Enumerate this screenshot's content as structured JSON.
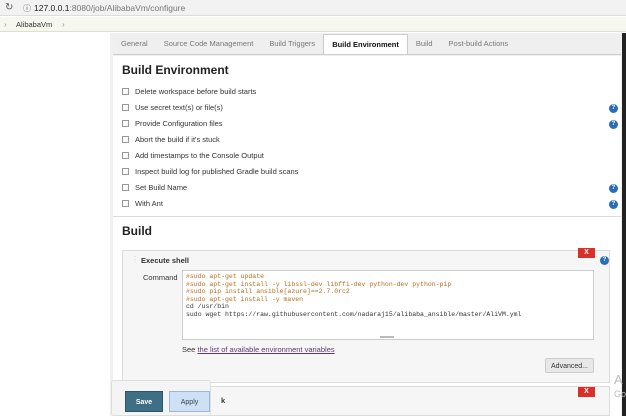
{
  "browser": {
    "reload_icon": "reload-icon",
    "info_icon": "info-icon",
    "url_host": "127.0.0.1",
    "url_rest": ":8080/job/AlibabaVm/configure"
  },
  "breadcrumb": {
    "item": "AlibabaVm",
    "sep": "›"
  },
  "tabs": [
    "General",
    "Source Code Management",
    "Build Triggers",
    "Build Environment",
    "Build",
    "Post-build Actions"
  ],
  "build_env": {
    "title": "Build Environment",
    "options": [
      {
        "label": "Delete workspace before build starts",
        "help": false
      },
      {
        "label": "Use secret text(s) or file(s)",
        "help": true
      },
      {
        "label": "Provide Configuration files",
        "help": true
      },
      {
        "label": "Abort the build if it's stuck",
        "help": false
      },
      {
        "label": "Add timestamps to the Console Output",
        "help": false
      },
      {
        "label": "Inspect build log for published Gradle build scans",
        "help": false
      },
      {
        "label": "Set Build Name",
        "help": true
      },
      {
        "label": "With Ant",
        "help": true
      }
    ]
  },
  "build": {
    "title": "Build",
    "step_title": "Execute shell",
    "delete_label": "X",
    "command_label": "Command",
    "command_lines": [
      "#sudo apt-get update",
      "#sudo apt-get install -y libssl-dev libffi-dev python-dev python-pip",
      "#sudo pip install ansible[azure]==2.7.0rc2",
      "#sudo apt-get install -y maven",
      "cd /usr/bin",
      "sudo wget https://raw.githubusercontent.com/nadaraj15/alibaba_ansible/master/AliVM.yml"
    ],
    "see_prefix": "See",
    "see_link": "the list of available environment variables",
    "advanced": "Advanced...",
    "next_step_partial": "k"
  },
  "footer": {
    "save": "Save",
    "apply": "Apply"
  },
  "watermark": {
    "line1": "A",
    "line2": "Go"
  }
}
